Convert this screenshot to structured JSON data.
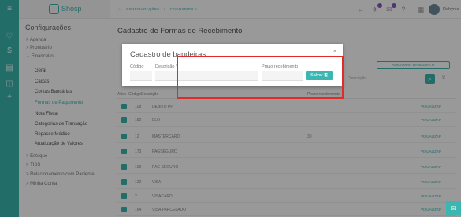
{
  "brand": {
    "name": "Shosp"
  },
  "topbar": {
    "breadcrumb": [
      "CONFIGURAÇÕES",
      ">",
      "FINANCEIRO",
      ">"
    ],
    "user": "Rahyres",
    "icons": [
      "search-icon",
      "rocket-icon",
      "chat-icon",
      "help-icon",
      "grid-icon",
      "settings-icon"
    ]
  },
  "sidebar": {
    "title": "Configurações",
    "items": [
      {
        "label": "> Agenda"
      },
      {
        "label": "> Prontuário"
      },
      {
        "label": "⌄ Financeiro"
      },
      {
        "label": "Geral"
      },
      {
        "label": "Caixas"
      },
      {
        "label": "Contas Bancárias"
      },
      {
        "label": "Formas de Pagamento"
      },
      {
        "label": "Nota Fiscal"
      },
      {
        "label": "Categorias de Transação"
      },
      {
        "label": "Repasse Médico"
      },
      {
        "label": "Atualização de Valores"
      },
      {
        "label": "> Estoque"
      },
      {
        "label": "> TISS"
      },
      {
        "label": "> Relacionamento com Paciente"
      },
      {
        "label": "> Minha Conta"
      }
    ]
  },
  "page": {
    "title": "Cadastro de Formas de Recebimento",
    "add_button": "ADICIONAR BANDEIRA ⊕",
    "filter_placeholder": "Descrição",
    "columns": [
      "Ativo",
      "Código",
      "Descrição",
      "Prazo recebimento"
    ],
    "rows": [
      {
        "code": "108",
        "desc": "DEBITO PP",
        "prazo": "",
        "action": "VISUALIZAR"
      },
      {
        "code": "152",
        "desc": "ELO",
        "prazo": "",
        "action": "VISUALIZAR"
      },
      {
        "code": "12",
        "desc": "MASTERCARD",
        "prazo": "30",
        "action": "VISUALIZAR"
      },
      {
        "code": "173",
        "desc": "PAGSEGURO",
        "prazo": "",
        "action": "VISUALIZAR"
      },
      {
        "code": "109",
        "desc": "PAG SEGURO",
        "prazo": "",
        "action": "VISUALIZAR"
      },
      {
        "code": "122",
        "desc": "VISA",
        "prazo": "",
        "action": "VISUALIZAR"
      },
      {
        "code": "2",
        "desc": "VISACARD",
        "prazo": "",
        "action": "VISUALIZAR"
      },
      {
        "code": "164",
        "desc": "VISA PARCELADO",
        "prazo": "",
        "action": "VISUALIZAR"
      }
    ]
  },
  "modal": {
    "title": "Cadastro de bandeiras",
    "label_code": "Código",
    "label_desc": "Descrição *",
    "label_prazo": "Prazo recebimento",
    "save": "Salvar 🖫",
    "close": "×"
  },
  "colors": {
    "accent": "#3bb6b0",
    "highlight": "#e02b2b",
    "badge": "#8d54c6"
  }
}
